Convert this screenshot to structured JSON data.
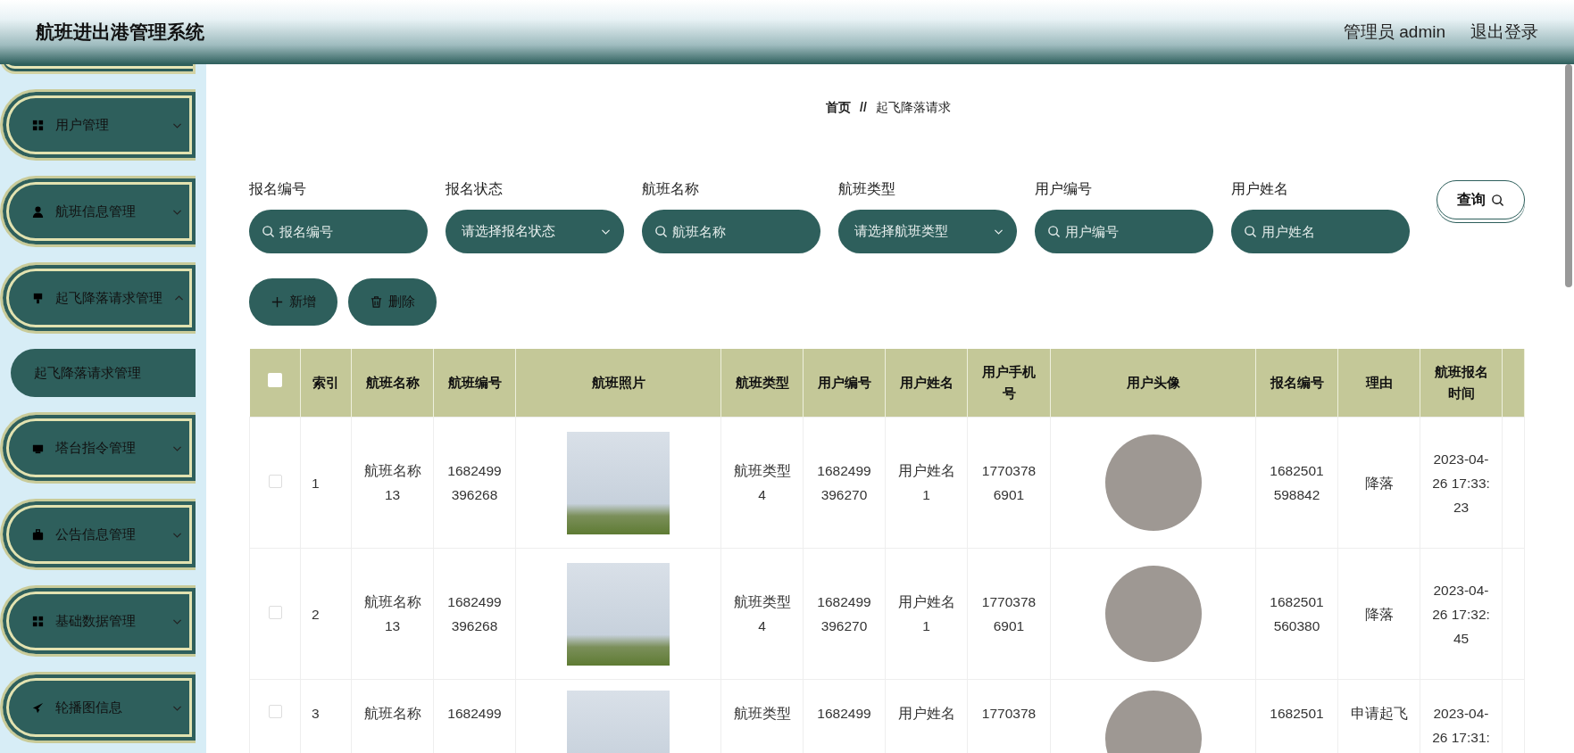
{
  "header": {
    "title": "航班进出港管理系统",
    "user_label": "管理员 admin",
    "logout": "退出登录"
  },
  "sidebar": {
    "items": [
      {
        "label": "用户管理",
        "expanded": false
      },
      {
        "label": "航班信息管理",
        "expanded": false
      },
      {
        "label": "起飞降落请求管理",
        "expanded": true,
        "children": [
          {
            "label": "起飞降落请求管理"
          }
        ]
      },
      {
        "label": "塔台指令管理",
        "expanded": false
      },
      {
        "label": "公告信息管理",
        "expanded": false
      },
      {
        "label": "基础数据管理",
        "expanded": false
      },
      {
        "label": "轮播图信息",
        "expanded": false
      }
    ]
  },
  "breadcrumb": {
    "home": "首页",
    "separator": "//",
    "current": "起飞降落请求"
  },
  "filters": [
    {
      "label": "报名编号",
      "kind": "text",
      "placeholder": "报名编号"
    },
    {
      "label": "报名状态",
      "kind": "select",
      "placeholder": "请选择报名状态"
    },
    {
      "label": "航班名称",
      "kind": "text",
      "placeholder": "航班名称"
    },
    {
      "label": "航班类型",
      "kind": "select",
      "placeholder": "请选择航班类型"
    },
    {
      "label": "用户编号",
      "kind": "text",
      "placeholder": "用户编号"
    },
    {
      "label": "用户姓名",
      "kind": "text",
      "placeholder": "用户姓名"
    }
  ],
  "search_button": "查询",
  "actions": [
    {
      "kind": "add",
      "label": "新增"
    },
    {
      "kind": "delete",
      "label": "删除"
    }
  ],
  "table": {
    "select_all_checked": false,
    "columns": [
      "索引",
      "航班名称",
      "航班编号",
      "航班照片",
      "航班类型",
      "用户编号",
      "用户姓名",
      "用户手机号",
      "用户头像",
      "报名编号",
      "理由",
      "航班报名时间"
    ],
    "rows": [
      {
        "checked": false,
        "index": "1",
        "flight_name": "航班名称13",
        "flight_no": "1682499396268",
        "flight_type": "航班类型4",
        "user_no": "1682499396270",
        "user_name": "用户姓名1",
        "phone": "17703786901",
        "apply_no": "1682501598842",
        "reason": "降落",
        "apply_time": "2023-04-26 17:33:23"
      },
      {
        "checked": false,
        "index": "2",
        "flight_name": "航班名称13",
        "flight_no": "1682499396268",
        "flight_type": "航班类型4",
        "user_no": "1682499396270",
        "user_name": "用户姓名1",
        "phone": "17703786901",
        "apply_no": "1682501560380",
        "reason": "降落",
        "apply_time": "2023-04-26 17:32:45"
      },
      {
        "checked": false,
        "index": "3",
        "flight_name": "航班名称",
        "flight_no": "1682499",
        "flight_type": "航班类型",
        "user_no": "1682499",
        "user_name": "用户姓名",
        "phone": "1770378",
        "apply_no": "1682501",
        "reason": "申请起飞",
        "apply_time": "2023-04-26 17:31:"
      }
    ]
  }
}
